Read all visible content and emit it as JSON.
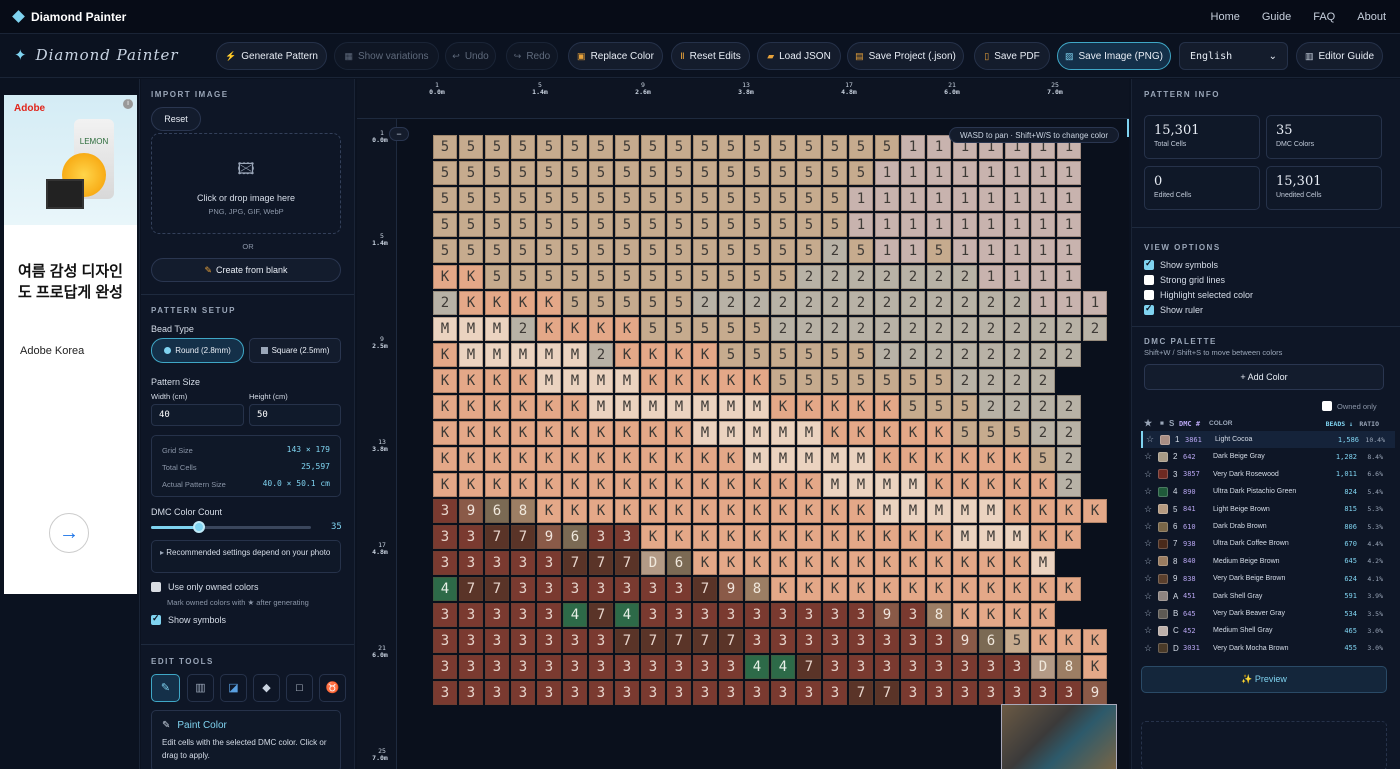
{
  "nav": {
    "brand": "Diamond Painter",
    "links": [
      "Home",
      "Guide",
      "FAQ",
      "About"
    ]
  },
  "toolbar": {
    "logo": "Diamond Painter",
    "buttons": [
      {
        "label": "Generate Pattern",
        "icon": "bolt-icon",
        "glyph": "⚡",
        "state": "normal"
      },
      {
        "label": "Show variations",
        "icon": "variations-icon",
        "glyph": "▦",
        "state": "disabled"
      },
      {
        "label": "Undo",
        "icon": "undo-icon",
        "glyph": "↩",
        "state": "disabled"
      },
      {
        "label": "Redo",
        "icon": "redo-icon",
        "glyph": "↪",
        "state": "disabled"
      },
      {
        "label": "Replace Color",
        "icon": "replace-icon",
        "glyph": "▣",
        "state": "normal"
      },
      {
        "label": "Reset Edits",
        "icon": "reset-icon",
        "glyph": "Ⅱ",
        "state": "normal"
      },
      {
        "label": "Load JSON",
        "icon": "folder-icon",
        "glyph": "▰",
        "state": "normal"
      },
      {
        "label": "Save Project (.json)",
        "icon": "save-icon",
        "glyph": "▤",
        "state": "normal"
      },
      {
        "label": "Save PDF",
        "icon": "pdf-icon",
        "glyph": "▯",
        "state": "normal"
      },
      {
        "label": "Save Image (PNG)",
        "icon": "image-icon",
        "glyph": "▨",
        "state": "highlight"
      }
    ],
    "language": "English",
    "editor_guide": "Editor Guide"
  },
  "ad": {
    "brand": "Adobe",
    "product": "LEMON",
    "headline": "여름 감성 디자인도 프로답게 완성",
    "advertiser": "Adobe Korea"
  },
  "import": {
    "section": "IMPORT IMAGE",
    "reset": "Reset",
    "drop_title": "Click or drop image here",
    "drop_formats": "PNG, JPG, GIF, WebP",
    "or": "OR",
    "blank": "Create from blank"
  },
  "setup": {
    "section": "PATTERN SETUP",
    "bead_type": "Bead Type",
    "round": "Round (2.8mm)",
    "square": "Square (2.5mm)",
    "pattern_size": "Pattern Size",
    "width_label": "Width (cm)",
    "height_label": "Height (cm)",
    "width": "40",
    "height": "50",
    "grid_size_label": "Grid Size",
    "grid_size": "143 × 179",
    "total_cells_label": "Total Cells",
    "total_cells": "25,597",
    "actual_label": "Actual Pattern Size",
    "actual": "40.0 × 50.1 cm",
    "color_count_label": "DMC Color Count",
    "color_count": "35",
    "color_count_fraction": 0.3,
    "recommend": "Recommended settings depend on your photo",
    "owned_only": "Use only owned colors",
    "owned_hint": "Mark owned colors with ★ after generating",
    "show_symbols": "Show symbols"
  },
  "edit": {
    "section": "EDIT TOOLS",
    "tool_title": "Paint Color",
    "tool_desc": "Edit cells with the selected DMC color. Click or drag to apply."
  },
  "canvas": {
    "hint": "WASD to pan · Shift+W/S to change color",
    "ruler_top": [
      {
        "n": "1",
        "m": "0.0m"
      },
      {
        "n": "5",
        "m": "1.4m"
      },
      {
        "n": "9",
        "m": "2.6m"
      },
      {
        "n": "13",
        "m": "3.8m"
      },
      {
        "n": "17",
        "m": "4.8m"
      },
      {
        "n": "21",
        "m": "6.0m"
      },
      {
        "n": "25",
        "m": "7.0m"
      }
    ],
    "ruler_left": [
      {
        "n": "1",
        "m": "0.0m"
      },
      {
        "n": "5",
        "m": "1.4m"
      },
      {
        "n": "9",
        "m": "2.5m"
      },
      {
        "n": "13",
        "m": "3.8m"
      },
      {
        "n": "17",
        "m": "4.8m"
      },
      {
        "n": "21",
        "m": "6.0m"
      },
      {
        "n": "25",
        "m": "7.0m"
      }
    ],
    "zoom_minus": "−",
    "rows": [
      "5555555555555555551111111",
      "5555555555555555511111111",
      "5555555555555555111111111",
      "5555555555555555111111111",
      "5555555555555552511511111",
      "KK55555555555522222221111",
      "2KKKK555552222222222222111",
      "MMM2KKKK555552222222222222",
      "KMMMMM2KKKK55555522222222",
      "KKKKMMMMKKKKK55555552222",
      "KKKKKKMMMMMMMKKKKK5552222",
      "KKKKKKKKKKMMMMMKKKKK55522",
      "KKKKKKKKKKKKMMMMMKKKKKK52",
      "KKKKKKKKKKKKKKKMMMMKKKKK2",
      "3968KKKKKKKKKKKKKMMMMMKKKK",
      "33779633KKKKKKKKKKKKMMMKK",
      "33333777D6KKKKKKKKKKKKKM",
      "4773333333798KKKKKKKKKKKK",
      "33333474333333333938KKKK",
      "33333337777733333333965KKK",
      "33333333333344733333333D8K",
      "33333333333333337733333339"
    ]
  },
  "info": {
    "section": "PATTERN INFO",
    "stats": [
      {
        "v": "15,301",
        "k": "Total Cells"
      },
      {
        "v": "35",
        "k": "DMC Colors"
      },
      {
        "v": "0",
        "k": "Edited Cells"
      },
      {
        "v": "15,301",
        "k": "Unedited Cells"
      }
    ],
    "view_section": "VIEW OPTIONS",
    "view": [
      {
        "label": "Show symbols",
        "on": true
      },
      {
        "label": "Strong grid lines",
        "on": false
      },
      {
        "label": "Highlight selected color",
        "on": false
      },
      {
        "label": "Show ruler",
        "on": true
      }
    ],
    "palette_section": "DMC PALETTE",
    "palette_hint": "Shift+W / Shift+S to move between colors",
    "add_color": "+ Add Color",
    "owned_only": "Owned only",
    "headers": {
      "star": "★",
      "sw": "■",
      "sym": "S",
      "dmc": "DMC #",
      "color": "COLOR",
      "beads": "BEADS ↓",
      "ratio": "RATIO"
    },
    "preview": "✨ Preview",
    "palette": [
      {
        "sym": "1",
        "dmc": "3861",
        "name": "Light Cocoa",
        "beads": "1,586",
        "ratio": "10.4%",
        "color": "#a98e84"
      },
      {
        "sym": "2",
        "dmc": "642",
        "name": "Dark Beige Gray",
        "beads": "1,282",
        "ratio": "8.4%",
        "color": "#a79a86"
      },
      {
        "sym": "3",
        "dmc": "3857",
        "name": "Very Dark Rosewood",
        "beads": "1,011",
        "ratio": "6.6%",
        "color": "#6e2a22"
      },
      {
        "sym": "4",
        "dmc": "890",
        "name": "Ultra Dark Pistachio Green",
        "beads": "824",
        "ratio": "5.4%",
        "color": "#1f5a3a"
      },
      {
        "sym": "5",
        "dmc": "841",
        "name": "Light Beige Brown",
        "beads": "815",
        "ratio": "5.3%",
        "color": "#b59a80"
      },
      {
        "sym": "6",
        "dmc": "610",
        "name": "Dark Drab Brown",
        "beads": "806",
        "ratio": "5.3%",
        "color": "#7a6748"
      },
      {
        "sym": "7",
        "dmc": "938",
        "name": "Ultra Dark Coffee Brown",
        "beads": "670",
        "ratio": "4.4%",
        "color": "#4a2a1a"
      },
      {
        "sym": "8",
        "dmc": "840",
        "name": "Medium Beige Brown",
        "beads": "645",
        "ratio": "4.2%",
        "color": "#9a7c60"
      },
      {
        "sym": "9",
        "dmc": "838",
        "name": "Very Dark Beige Brown",
        "beads": "624",
        "ratio": "4.1%",
        "color": "#5a3f2c"
      },
      {
        "sym": "A",
        "dmc": "451",
        "name": "Dark Shell Gray",
        "beads": "591",
        "ratio": "3.9%",
        "color": "#8e8480"
      },
      {
        "sym": "B",
        "dmc": "645",
        "name": "Very Dark Beaver Gray",
        "beads": "534",
        "ratio": "3.5%",
        "color": "#5e5a54"
      },
      {
        "sym": "C",
        "dmc": "452",
        "name": "Medium Shell Gray",
        "beads": "465",
        "ratio": "3.0%",
        "color": "#bdb0aa"
      },
      {
        "sym": "D",
        "dmc": "3031",
        "name": "Very Dark Mocha Brown",
        "beads": "455",
        "ratio": "3.0%",
        "color": "#4a3a28"
      }
    ]
  }
}
